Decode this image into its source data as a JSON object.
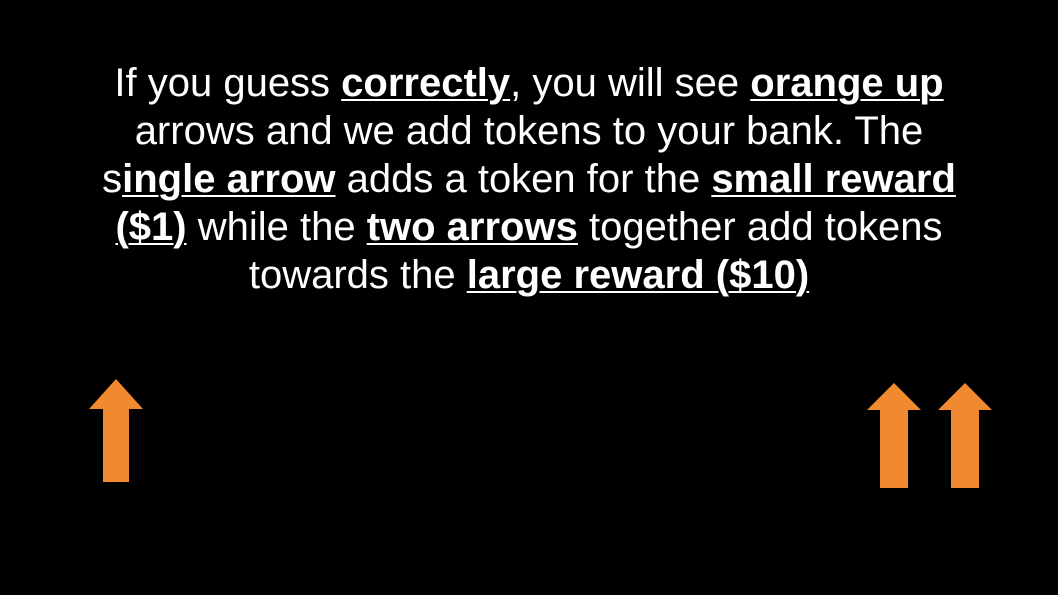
{
  "instruction": {
    "line1_a": "If you guess ",
    "line1_emph1": "correctly",
    "line1_b": ", you will see ",
    "line1_emph2": "orange up",
    "line2": "arrows and we add tokens to your bank. The",
    "line3_a": "s",
    "line3_emph1": "ingle arrow",
    "line3_b": " adds a token for the ",
    "line3_emph2": "small reward",
    "line4_emph1": "($1)",
    "line4_a": " while the ",
    "line4_emph2": "two arrows",
    "line4_b": " together add tokens",
    "line5_a": "towards the ",
    "line5_emph1": "large reward ($10)"
  },
  "arrows": {
    "single": {
      "icon": "up-arrow-icon",
      "count": 1
    },
    "double": {
      "icon": "up-arrow-icon",
      "count": 2
    }
  },
  "colors": {
    "background": "#000000",
    "text": "#ffffff",
    "arrow": "#f0892f"
  }
}
